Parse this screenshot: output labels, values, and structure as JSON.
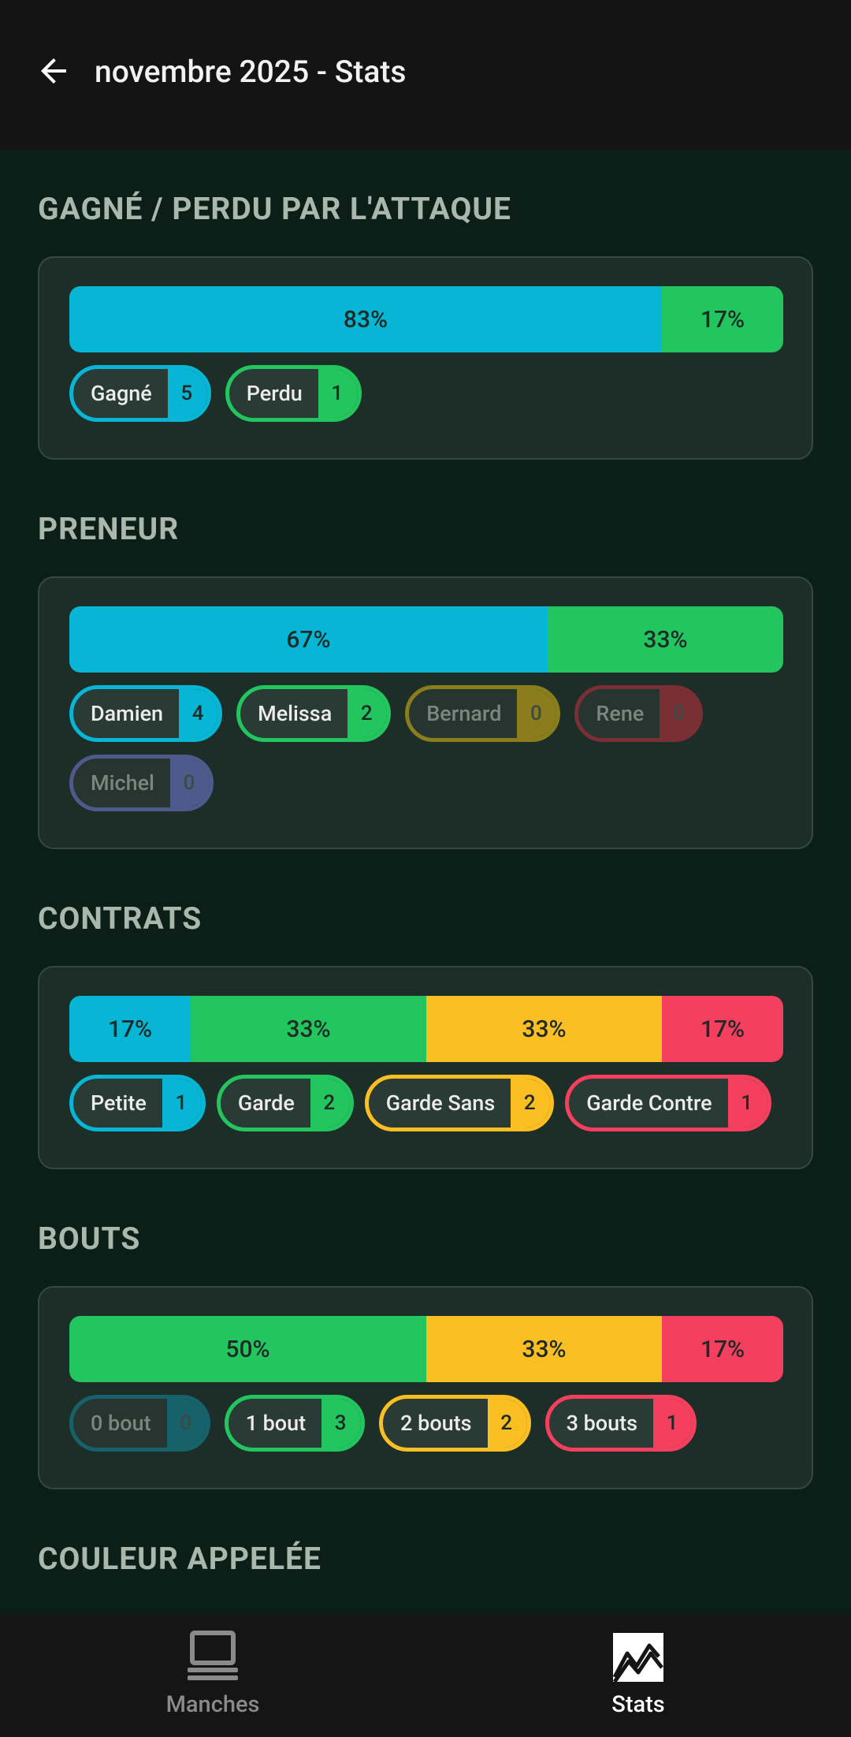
{
  "header": {
    "title": "novembre 2025 - Stats",
    "back_icon": "arrow-left-icon"
  },
  "sections": {
    "attaque": {
      "title": "GAGNÉ / PERDU PAR L'ATTAQUE",
      "bar": [
        {
          "label": "83%",
          "value": 83,
          "color": "#06b6d4"
        },
        {
          "label": "17%",
          "value": 17,
          "color": "#22c55e"
        }
      ],
      "chips": [
        {
          "label": "Gagné",
          "count": "5",
          "color": "#06b6d4"
        },
        {
          "label": "Perdu",
          "count": "1",
          "color": "#22c55e"
        }
      ]
    },
    "preneur": {
      "title": "PRENEUR",
      "bar": [
        {
          "label": "67%",
          "value": 67,
          "color": "#06b6d4"
        },
        {
          "label": "33%",
          "value": 33,
          "color": "#22c55e"
        }
      ],
      "chips": [
        {
          "label": "Damien",
          "count": "4",
          "color": "#06b6d4"
        },
        {
          "label": "Melissa",
          "count": "2",
          "color": "#22c55e"
        },
        {
          "label": "Bernard",
          "count": "0",
          "color": "#8a7d1c"
        },
        {
          "label": "Rene",
          "count": "0",
          "color": "#7a2f35"
        },
        {
          "label": "Michel",
          "count": "0",
          "color": "#4f5a8c"
        }
      ]
    },
    "contrats": {
      "title": "CONTRATS",
      "bar": [
        {
          "label": "17%",
          "value": 17,
          "color": "#06b6d4"
        },
        {
          "label": "33%",
          "value": 33,
          "color": "#22c55e"
        },
        {
          "label": "33%",
          "value": 33,
          "color": "#fbbf24"
        },
        {
          "label": "17%",
          "value": 17,
          "color": "#f43f5e"
        }
      ],
      "chips": [
        {
          "label": "Petite",
          "count": "1",
          "color": "#06b6d4"
        },
        {
          "label": "Garde",
          "count": "2",
          "color": "#22c55e"
        },
        {
          "label": "Garde Sans",
          "count": "2",
          "color": "#fbbf24"
        },
        {
          "label": "Garde Contre",
          "count": "1",
          "color": "#f43f5e"
        }
      ]
    },
    "bouts": {
      "title": "BOUTS",
      "bar": [
        {
          "label": "50%",
          "value": 50,
          "color": "#22c55e"
        },
        {
          "label": "33%",
          "value": 33,
          "color": "#fbbf24"
        },
        {
          "label": "17%",
          "value": 17,
          "color": "#f43f5e"
        }
      ],
      "chips": [
        {
          "label": "0 bout",
          "count": "0",
          "color": "#16616a"
        },
        {
          "label": "1 bout",
          "count": "3",
          "color": "#22c55e"
        },
        {
          "label": "2 bouts",
          "count": "2",
          "color": "#fbbf24"
        },
        {
          "label": "3 bouts",
          "count": "1",
          "color": "#f43f5e"
        }
      ]
    },
    "couleur": {
      "title": "COULEUR APPELÉE"
    }
  },
  "bottom_nav": {
    "manches_label": "Manches",
    "manches_icon": "laptop-icon",
    "stats_label": "Stats",
    "stats_icon": "chart-line-icon",
    "active": "Stats"
  }
}
